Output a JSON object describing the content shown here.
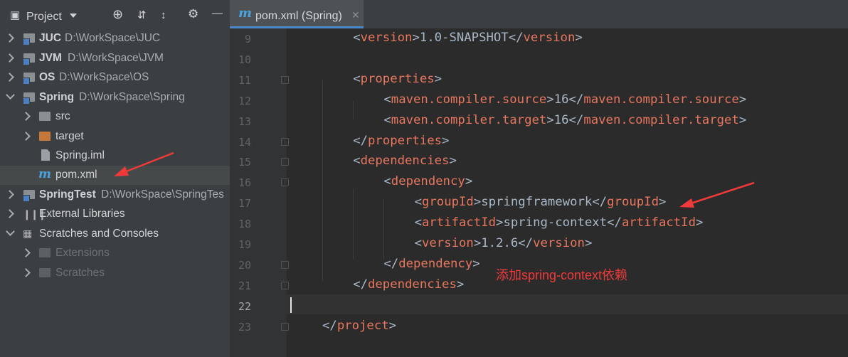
{
  "project_panel": {
    "title": "Project",
    "tree": [
      {
        "name": "JUC",
        "path": "D:\\WorkSpace\\JUC"
      },
      {
        "name": "JVM",
        "path": "D:\\WorkSpace\\JVM"
      },
      {
        "name": "OS",
        "path": "D:\\WorkSpace\\OS"
      },
      {
        "name": "Spring",
        "path": "D:\\WorkSpace\\Spring",
        "children": [
          {
            "name": "src"
          },
          {
            "name": "target"
          },
          {
            "name": "Spring.iml"
          },
          {
            "name": "pom.xml"
          }
        ]
      },
      {
        "name": "SpringTest",
        "path": "D:\\WorkSpace\\SpringTes"
      },
      {
        "name": "External Libraries"
      },
      {
        "name": "Scratches and Consoles",
        "children": [
          {
            "name": "Extensions"
          },
          {
            "name": "Scratches"
          }
        ]
      }
    ]
  },
  "editor": {
    "tab_label": "pom.xml (Spring)",
    "tab_icon": "maven-icon",
    "lines": [
      {
        "num": "9",
        "open": "version",
        "text": "1.0-SNAPSHOT",
        "close": "version"
      },
      {
        "num": "10"
      },
      {
        "num": "11",
        "open": "properties"
      },
      {
        "num": "12",
        "open": "maven.compiler.source",
        "text": "16",
        "close": "maven.compiler.source"
      },
      {
        "num": "13",
        "open": "maven.compiler.target",
        "text": "16",
        "close": "maven.compiler.target"
      },
      {
        "num": "14",
        "close": "properties"
      },
      {
        "num": "15",
        "open": "dependencies"
      },
      {
        "num": "16",
        "open": "dependency"
      },
      {
        "num": "17",
        "open": "groupId",
        "text": "springframework",
        "close": "groupId"
      },
      {
        "num": "18",
        "open": "artifactId",
        "text": "spring-context",
        "close": "artifactId"
      },
      {
        "num": "19",
        "open": "version",
        "text": "1.2.6",
        "close": "version"
      },
      {
        "num": "20",
        "close": "dependency"
      },
      {
        "num": "21",
        "close": "dependencies"
      },
      {
        "num": "22"
      },
      {
        "num": "23",
        "close": "project"
      }
    ],
    "current_line": "22"
  },
  "annotation": {
    "note": "添加spring-context依赖",
    "color": "#f03a3a"
  },
  "colors": {
    "tag": "#e8765e",
    "text": "#a9b7c6",
    "accent": "#4a88c7"
  }
}
